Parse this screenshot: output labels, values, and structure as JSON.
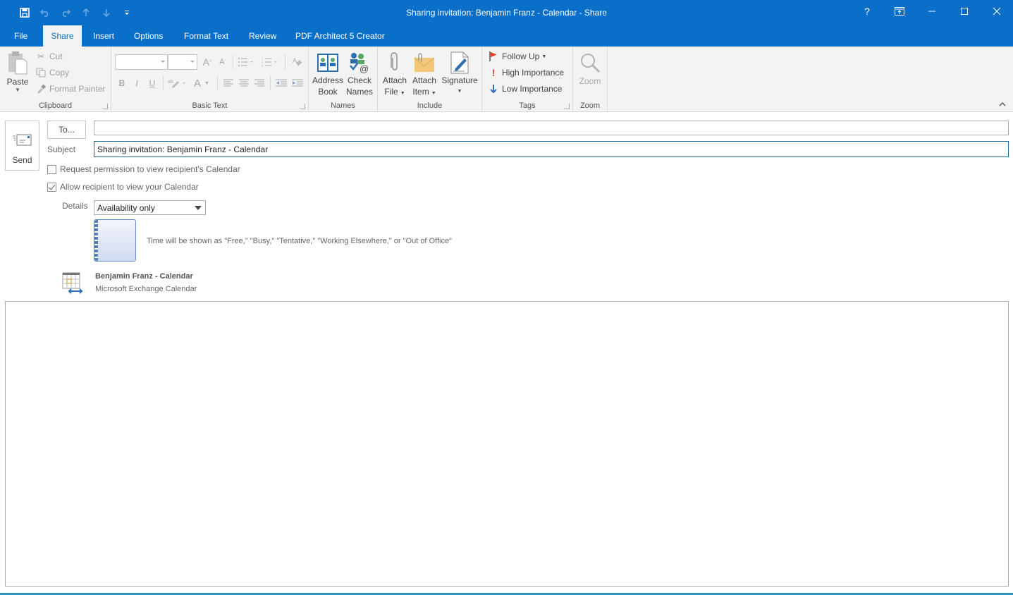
{
  "window": {
    "title": "Sharing invitation: Benjamin Franz - Calendar  -  Share",
    "controls": [
      "help-icon",
      "ribbon-display-options-icon",
      "minimize-icon",
      "maximize-icon",
      "close-icon"
    ],
    "help_glyph": "?"
  },
  "qat": {
    "icons": [
      "save-icon",
      "undo-icon",
      "redo-icon",
      "up-arrow-icon",
      "down-arrow-icon",
      "customize-qat-icon"
    ]
  },
  "tabs": [
    {
      "label": "File",
      "active": false
    },
    {
      "label": "Share",
      "active": true
    },
    {
      "label": "Insert",
      "active": false
    },
    {
      "label": "Options",
      "active": false
    },
    {
      "label": "Format Text",
      "active": false
    },
    {
      "label": "Review",
      "active": false
    },
    {
      "label": "PDF Architect 5 Creator",
      "active": false
    }
  ],
  "ribbon": {
    "clipboard": {
      "label": "Clipboard",
      "paste": "Paste",
      "cut": "Cut",
      "copy": "Copy",
      "format_painter": "Format Painter"
    },
    "basic_text": {
      "label": "Basic Text",
      "font_name": "",
      "font_size": "",
      "bold": "B",
      "italic": "I",
      "underline": "U",
      "grow_font": "A",
      "shrink_font": "A",
      "font_color": "A"
    },
    "names": {
      "label": "Names",
      "address_book": [
        "Address",
        "Book"
      ],
      "check_names": [
        "Check",
        "Names"
      ]
    },
    "include": {
      "label": "Include",
      "attach_file": [
        "Attach",
        "File"
      ],
      "attach_item": [
        "Attach",
        "Item"
      ],
      "signature": "Signature"
    },
    "tags": {
      "label": "Tags",
      "follow_up": "Follow Up",
      "high_importance": "High Importance",
      "low_importance": "Low Importance"
    },
    "zoom": {
      "label": "Zoom",
      "zoom_button": "Zoom"
    }
  },
  "compose": {
    "send_label": "Send",
    "to_label": "To...",
    "to_value": "",
    "subject_label": "Subject",
    "subject_value": "Sharing invitation: Benjamin Franz - Calendar",
    "request_permission": {
      "label": "Request permission to view recipient's Calendar",
      "checked": false
    },
    "allow_recipient": {
      "label": "Allow recipient to view your Calendar",
      "checked": true
    },
    "details_label": "Details",
    "details_value": "Availability only",
    "details_description": "Time will be shown as \"Free,\" \"Busy,\" \"Tentative,\" \"Working Elsewhere,\" or \"Out of Office\"",
    "calendar_name": "Benjamin Franz - Calendar",
    "calendar_type": "Microsoft Exchange Calendar",
    "body": ""
  },
  "colors": {
    "title_bar": "#0a6fc9",
    "ribbon_bg": "#f3f3f3",
    "subject_focus_border": "#1f6f9a",
    "follow_up_flag": "#d9442b",
    "high_importance": "#d9442b",
    "low_importance": "#2e6fc0"
  }
}
